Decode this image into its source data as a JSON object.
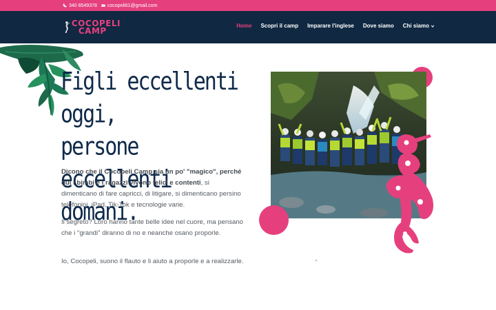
{
  "topbar": {
    "phone": "340 8549378",
    "email": "cocopeli61@gmail.com",
    "phone_icon": "phone-icon",
    "email_icon": "envelope-icon"
  },
  "header": {
    "logo_line1": "COCOPELI",
    "logo_line2": "CAMP",
    "nav": [
      {
        "label": "Home"
      },
      {
        "label": "Scopri il camp"
      },
      {
        "label": "Imparare l'inglese"
      },
      {
        "label": "Dove siamo"
      },
      {
        "label": "Chi siamo"
      }
    ]
  },
  "hero": {
    "headline_line1": "Figli eccellenti oggi,",
    "headline_line2": "persone eccellenti",
    "headline_line3": "domani.",
    "p1_bold": "Dicono che il Cocopeli Camp sia un po' \"magico\", perché qui i bimbi e i ragazzi vivono felici e contenti",
    "p1_rest": ", si dimenticano di fare capricci, di litigare, si dimenticano persino telefonini, iPad, Tik-Tok e tecnologie varie.",
    "p2": "Il segreto? Loro hanno tante belle idee nel cuore, ma pensano che i \"grandi\" diranno di no e neanche osano proporle.",
    "p3": "Io, Cocopeli, suono il flauto e li aiuto a proporle e a realizzarle."
  },
  "colors": {
    "accent": "#e5407d",
    "header_bg": "#102841",
    "headline": "#0f2a4a"
  }
}
